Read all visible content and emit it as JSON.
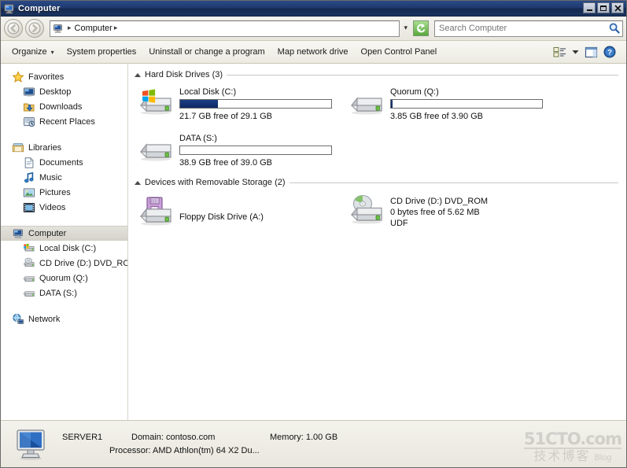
{
  "window": {
    "title": "Computer",
    "title_icon": "computer-icon",
    "controls": {
      "minimize": "Minimize",
      "maximize": "Maximize",
      "close": "Close"
    }
  },
  "addressbar": {
    "back_label": "Back",
    "forward_label": "Forward",
    "icon": "computer-icon",
    "crumb": "Computer",
    "separator": "▸",
    "dropdown": "▾",
    "refresh_label": "Refresh",
    "search": {
      "placeholder": "Search Computer",
      "value": "",
      "icon": "search-icon"
    }
  },
  "toolbar": {
    "items": [
      {
        "label": "Organize",
        "has_caret": true,
        "caret": "▾"
      },
      {
        "label": "System properties",
        "has_caret": false
      },
      {
        "label": "Uninstall or change a program",
        "has_caret": false
      },
      {
        "label": "Map network drive",
        "has_caret": false
      },
      {
        "label": "Open Control Panel",
        "has_caret": false
      }
    ],
    "right_icons": [
      {
        "name": "views-icon",
        "label": "Change your view"
      },
      {
        "name": "chevron-down-icon",
        "label": "▾"
      },
      {
        "name": "preview-pane-icon",
        "label": "Show the preview pane"
      },
      {
        "name": "help-icon",
        "label": "Get help"
      }
    ]
  },
  "sidebar": {
    "groups": [
      {
        "header": {
          "label": "Favorites",
          "icon": "star-icon"
        },
        "items": [
          {
            "label": "Desktop",
            "icon": "desktop-icon"
          },
          {
            "label": "Downloads",
            "icon": "downloads-icon"
          },
          {
            "label": "Recent Places",
            "icon": "recent-places-icon"
          }
        ]
      },
      {
        "header": {
          "label": "Libraries",
          "icon": "libraries-icon"
        },
        "items": [
          {
            "label": "Documents",
            "icon": "document-icon"
          },
          {
            "label": "Music",
            "icon": "music-note-icon"
          },
          {
            "label": "Pictures",
            "icon": "picture-icon"
          },
          {
            "label": "Videos",
            "icon": "video-icon"
          }
        ]
      },
      {
        "header": {
          "label": "Computer",
          "icon": "computer-icon",
          "selected": true
        },
        "items": [
          {
            "label": "Local Disk (C:)",
            "icon": "hard-drive-windows-icon"
          },
          {
            "label": "CD Drive (D:) DVD_RO",
            "icon": "cd-drive-icon"
          },
          {
            "label": "Quorum (Q:)",
            "icon": "hard-drive-icon"
          },
          {
            "label": "DATA (S:)",
            "icon": "hard-drive-icon"
          }
        ]
      },
      {
        "header": {
          "label": "Network",
          "icon": "network-icon"
        },
        "items": []
      }
    ]
  },
  "content": {
    "groups": [
      {
        "title": "Hard Disk Drives (3)",
        "collapse_glyph": "▴",
        "drives": [
          {
            "name": "Local Disk (C:)",
            "icon": "hard-drive-windows-icon",
            "has_bar": true,
            "used_percent": 25,
            "bar_color": "#153a7c",
            "detail": "21.7 GB free of 29.1 GB",
            "extra": ""
          },
          {
            "name": "Quorum (Q:)",
            "icon": "hard-drive-icon",
            "has_bar": true,
            "used_percent": 1,
            "bar_color": "#153a7c",
            "detail": "3.85 GB free of 3.90 GB",
            "extra": ""
          },
          {
            "name": "DATA (S:)",
            "icon": "hard-drive-icon",
            "has_bar": true,
            "used_percent": 0,
            "bar_color": "#153a7c",
            "detail": "38.9 GB free of 39.0 GB",
            "extra": ""
          }
        ]
      },
      {
        "title": "Devices with Removable Storage (2)",
        "collapse_glyph": "▴",
        "drives": [
          {
            "name": "Floppy Disk Drive (A:)",
            "icon": "floppy-drive-icon",
            "has_bar": false,
            "used_percent": 0,
            "bar_color": "#153a7c",
            "detail": "",
            "extra": ""
          },
          {
            "name": "CD Drive (D:) DVD_ROM",
            "icon": "cd-drive-icon",
            "has_bar": false,
            "used_percent": 0,
            "bar_color": "#153a7c",
            "detail": "0 bytes free of 5.62 MB",
            "extra": "UDF"
          }
        ]
      }
    ]
  },
  "statusbar": {
    "icon": "computer-large-icon",
    "computer_name": "SERVER1",
    "domain": "Domain: contoso.com",
    "memory": "Memory: 1.00 GB",
    "processor": "Processor: AMD Athlon(tm) 64 X2 Du..."
  },
  "watermark": {
    "line1": "51CTO.com",
    "line2": "技术博客",
    "blog": "Blog"
  }
}
